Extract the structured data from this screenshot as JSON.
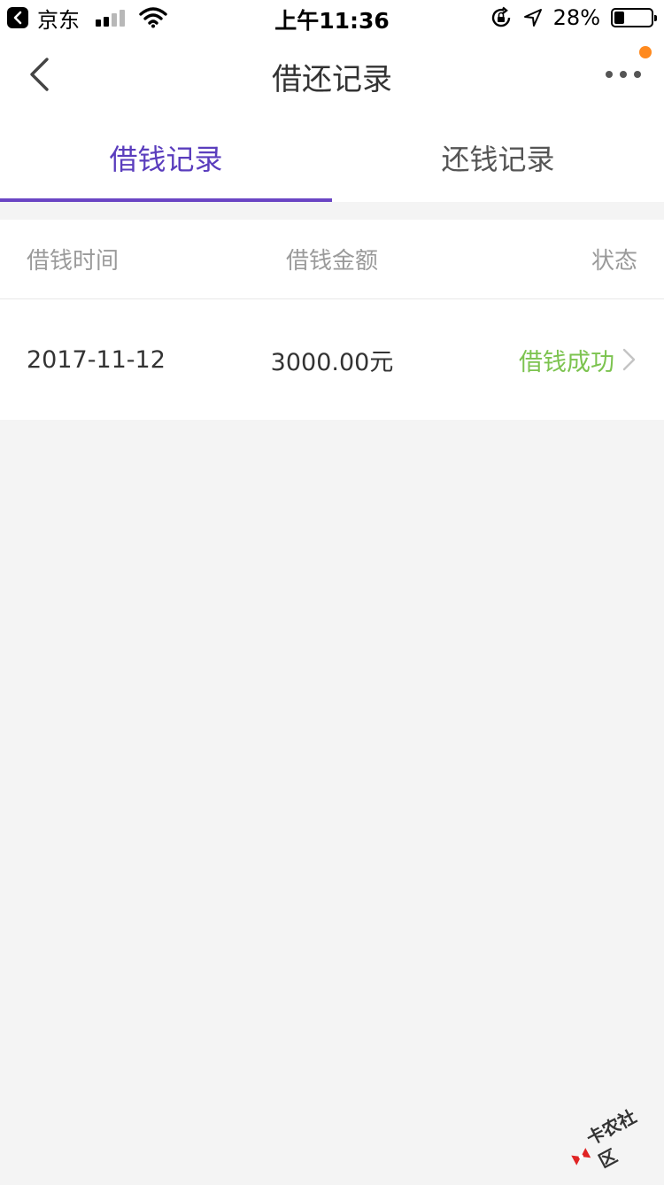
{
  "status_bar": {
    "back_app_label": "京东",
    "time": "上午11:36",
    "battery_percent": "28%",
    "battery_level": 0.28
  },
  "nav": {
    "title": "借还记录",
    "notification_color": "#ff8a1f"
  },
  "tabs": [
    {
      "label": "借钱记录",
      "active": true
    },
    {
      "label": "还钱记录",
      "active": false
    }
  ],
  "table": {
    "headers": {
      "time": "借钱时间",
      "amount": "借钱金额",
      "status": "状态"
    },
    "rows": [
      {
        "time": "2017-11-12",
        "amount": "3000.00元",
        "status": "借钱成功"
      }
    ]
  },
  "watermark": {
    "text": "卡农社区"
  },
  "colors": {
    "accent": "#6a45c4",
    "success": "#7cc34f",
    "background": "#f4f4f4"
  }
}
